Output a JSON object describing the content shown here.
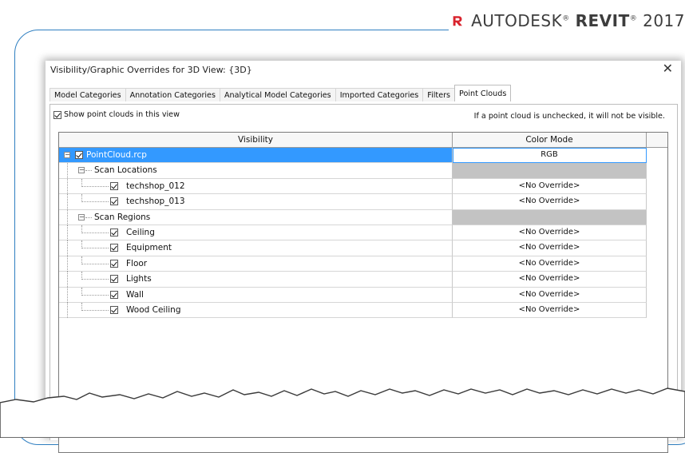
{
  "brand": {
    "prefix": "AUTODESK",
    "product": "REVIT",
    "version": "2017",
    "logo_color": "#d9232d"
  },
  "dialog": {
    "title": "Visibility/Graphic Overrides for 3D View: {3D}",
    "close_glyph": "✕",
    "tabs": [
      {
        "label": "Model Categories",
        "active": false
      },
      {
        "label": "Annotation Categories",
        "active": false
      },
      {
        "label": "Analytical Model Categories",
        "active": false
      },
      {
        "label": "Imported Categories",
        "active": false
      },
      {
        "label": "Filters",
        "active": false
      },
      {
        "label": "Point Clouds",
        "active": true
      }
    ],
    "show_checkbox_label": "Show point clouds in this view",
    "hint": "If a point cloud is unchecked, it will not be visible.",
    "columns": {
      "visibility": "Visibility",
      "color_mode": "Color Mode"
    },
    "rows": [
      {
        "name": "PointCloud.rcp",
        "mode": "RGB",
        "checked": true,
        "selected": true
      },
      {
        "name": "Scan Locations",
        "mode": "",
        "group": true
      },
      {
        "name": "techshop_012",
        "mode": "<No Override>",
        "checked": true
      },
      {
        "name": "techshop_013",
        "mode": "<No Override>",
        "checked": true
      },
      {
        "name": "Scan Regions",
        "mode": "",
        "group": true
      },
      {
        "name": "Ceiling",
        "mode": "<No Override>",
        "checked": true
      },
      {
        "name": "Equipment",
        "mode": "<No Override>",
        "checked": true
      },
      {
        "name": "Floor",
        "mode": "<No Override>",
        "checked": true
      },
      {
        "name": "Lights",
        "mode": "<No Override>",
        "checked": true
      },
      {
        "name": "Wall",
        "mode": "<No Override>",
        "checked": true
      },
      {
        "name": "Wood Ceiling",
        "mode": "<No Override>",
        "checked": true
      }
    ]
  },
  "colors": {
    "accent": "#3399ff",
    "frame": "#2f7fc1",
    "group_fill": "#c3c3c3"
  }
}
